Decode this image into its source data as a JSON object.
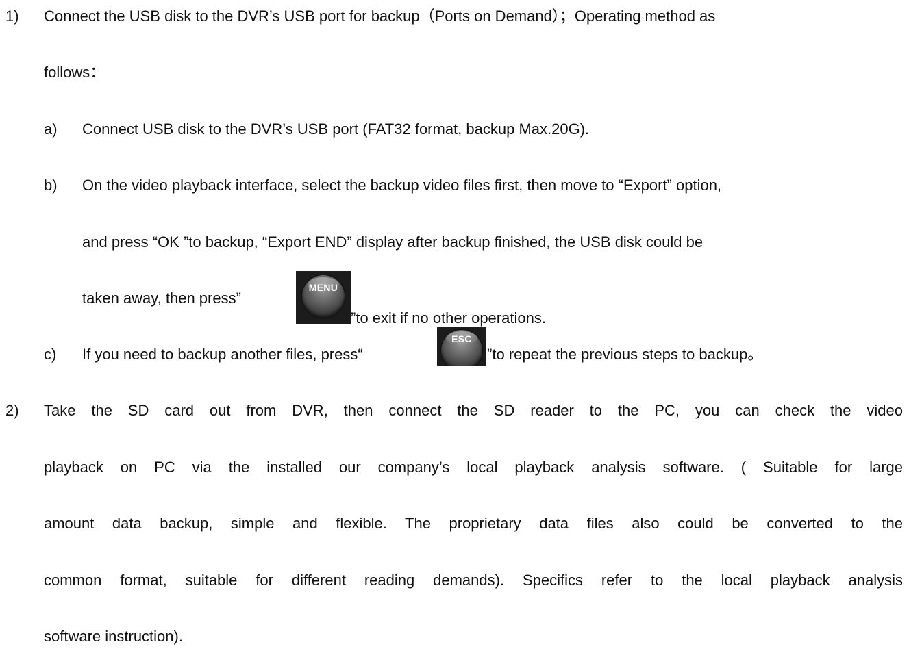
{
  "item1": {
    "marker": "1)",
    "line1": "Connect the USB disk to the DVR’s USB port for backup（Ports on Demand）；Operating method as",
    "line2": "follows："
  },
  "item1a": {
    "marker": "a)",
    "text": "Connect USB disk to the DVR’s USB port (FAT32 format, backup Max.20G)."
  },
  "item1b": {
    "marker": "b)",
    "line1": "On the video playback interface, select the backup video files first, then move to “Export” option,",
    "line2": "and press “OK ”to backup, “Export END” display after backup finished, the USB disk could be",
    "line3_before": "taken away, then press”",
    "line3_after": "”to exit if no other operations.",
    "menu_button_label": "MENU"
  },
  "item1c": {
    "marker": "c)",
    "text_before": "If you need to backup another files, press“",
    "text_after": "”to repeat the previous steps to backup。",
    "esc_button_label": "ESC"
  },
  "item2": {
    "marker": "2)",
    "line1": "Take the SD card out from DVR, then connect the SD reader to the PC, you can check the video",
    "line2": "playback on PC via the installed our company’s local playback analysis software. ( Suitable for large",
    "line3": "amount data backup, simple and flexible. The proprietary data files also could be converted to the",
    "line4": "common format, suitable for different reading demands). Specifics refer to the local playback analysis",
    "line5": "software instruction)."
  }
}
